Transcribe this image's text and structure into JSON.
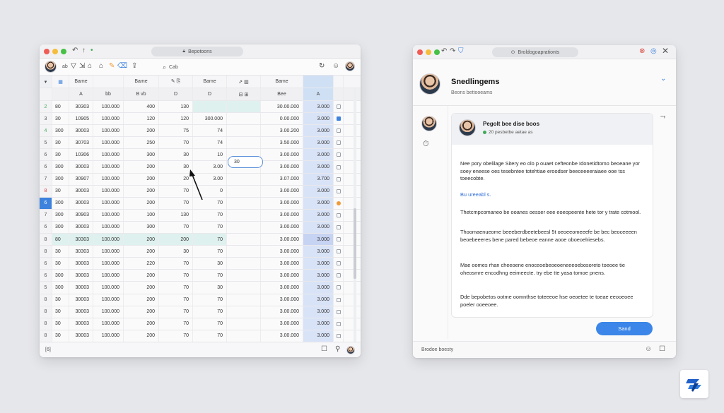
{
  "sheet_window": {
    "url_label": "Bepotoons",
    "toolbar": {
      "undo_label": "ab",
      "search_label": "Cab"
    },
    "col_headers_top": [
      "Bame",
      "Bame",
      "Bame",
      "Bame"
    ],
    "col_headers": [
      "A",
      "bb",
      "B vb",
      "D",
      "D",
      "Bee",
      "A"
    ],
    "rows": [
      {
        "n": "2",
        "c1": "80",
        "c2": "30303",
        "c3": "100.000",
        "c4": "400",
        "c5": "130",
        "c6": "",
        "c7": "",
        "c8": "30.00.000",
        "c9": "3.000",
        "hl": "teal"
      },
      {
        "n": "3",
        "c1": "30",
        "c2": "10905",
        "c3": "100.000",
        "c4": "120",
        "c5": "120",
        "c6": "300.000",
        "c7": "",
        "c8": "0.00.000",
        "c9": "3.000",
        "hl": ""
      },
      {
        "n": "4",
        "c1": "300",
        "c2": "30003",
        "c3": "100.000",
        "c4": "200",
        "c5": "75",
        "c6": "74",
        "c7": "",
        "c8": "3.00.200",
        "c9": "3.000",
        "hl": ""
      },
      {
        "n": "5",
        "c1": "30",
        "c2": "30703",
        "c3": "100.000",
        "c4": "250",
        "c5": "70",
        "c6": "74",
        "c7": "",
        "c8": "3.50.000",
        "c9": "3.000",
        "hl": ""
      },
      {
        "n": "6",
        "c1": "30",
        "c2": "10306",
        "c3": "100.000",
        "c4": "300",
        "c5": "30",
        "c6": "10",
        "c7": "",
        "c8": "3.00.000",
        "c9": "3.000",
        "hl": ""
      },
      {
        "n": "6",
        "c1": "300",
        "c2": "30003",
        "c3": "100.000",
        "c4": "200",
        "c5": "30",
        "c6": "3.00",
        "c7": "",
        "c8": "3.00.000",
        "c9": "3.000",
        "hl": ""
      },
      {
        "n": "7",
        "c1": "300",
        "c2": "30907",
        "c3": "100.000",
        "c4": "200",
        "c5": "20",
        "c6": "3.00",
        "c7": "",
        "c8": "3.07.000",
        "c9": "3.700",
        "hl": ""
      },
      {
        "n": "8",
        "c1": "30",
        "c2": "30003",
        "c3": "100.000",
        "c4": "200",
        "c5": "70",
        "c6": "0",
        "c7": "",
        "c8": "3.00.000",
        "c9": "3.000",
        "hl": ""
      },
      {
        "n": "6",
        "c1": "300",
        "c2": "30003",
        "c3": "100.000",
        "c4": "200",
        "c5": "70",
        "c6": "70",
        "c7": "",
        "c8": "3.00.000",
        "c9": "3.000",
        "hl": ""
      },
      {
        "n": "7",
        "c1": "300",
        "c2": "30903",
        "c3": "100.000",
        "c4": "100",
        "c5": "130",
        "c6": "70",
        "c7": "",
        "c8": "3.00.000",
        "c9": "3.000",
        "hl": ""
      },
      {
        "n": "6",
        "c1": "300",
        "c2": "30003",
        "c3": "100.000",
        "c4": "300",
        "c5": "70",
        "c6": "70",
        "c7": "",
        "c8": "3.00.000",
        "c9": "3.000",
        "hl": ""
      },
      {
        "n": "8",
        "c1": "80",
        "c2": "30303",
        "c3": "100.000",
        "c4": "200",
        "c5": "200",
        "c6": "70",
        "c7": "",
        "c8": "3.00.000",
        "c9": "3.000",
        "hl": ""
      },
      {
        "n": "8",
        "c1": "30",
        "c2": "30303",
        "c3": "100.000",
        "c4": "200",
        "c5": "30",
        "c6": "70",
        "c7": "",
        "c8": "3.00.000",
        "c9": "3.000",
        "hl": ""
      },
      {
        "n": "6",
        "c1": "30",
        "c2": "30003",
        "c3": "100.000",
        "c4": "220",
        "c5": "70",
        "c6": "30",
        "c7": "",
        "c8": "3.00.000",
        "c9": "3.000",
        "hl": ""
      },
      {
        "n": "6",
        "c1": "300",
        "c2": "30003",
        "c3": "100.000",
        "c4": "200",
        "c5": "70",
        "c6": "70",
        "c7": "",
        "c8": "3.00.000",
        "c9": "3.000",
        "hl": ""
      },
      {
        "n": "5",
        "c1": "300",
        "c2": "30003",
        "c3": "100.000",
        "c4": "200",
        "c5": "70",
        "c6": "30",
        "c7": "",
        "c8": "3.00.000",
        "c9": "3.000",
        "hl": ""
      },
      {
        "n": "8",
        "c1": "30",
        "c2": "30003",
        "c3": "100.000",
        "c4": "200",
        "c5": "70",
        "c6": "70",
        "c7": "",
        "c8": "3.00.000",
        "c9": "3.000",
        "hl": ""
      },
      {
        "n": "8",
        "c1": "30",
        "c2": "30003",
        "c3": "100.000",
        "c4": "200",
        "c5": "70",
        "c6": "70",
        "c7": "",
        "c8": "3.00.000",
        "c9": "3.000",
        "hl": ""
      },
      {
        "n": "8",
        "c1": "30",
        "c2": "30003",
        "c3": "100.000",
        "c4": "200",
        "c5": "70",
        "c6": "70",
        "c7": "",
        "c8": "3.00.000",
        "c9": "3.000",
        "hl": ""
      },
      {
        "n": "8",
        "c1": "30",
        "c2": "30003",
        "c3": "100.000",
        "c4": "200",
        "c5": "70",
        "c6": "70",
        "c7": "",
        "c8": "3.00.000",
        "c9": "3.000",
        "hl": ""
      }
    ],
    "input_chip": "30",
    "status_left": "[6]"
  },
  "mail_window": {
    "url_label": "Broldogoaprationts",
    "header_title": "Snedlingems",
    "header_subtitle": "Beons bettooeams",
    "card_sender": "Pegolt bee dise boos",
    "card_meta": "20 pesbetbe aetae as",
    "paragraphs": [
      "Nee pory obelilage Sitery eo olo p ouaet cefteonbe Idonetidtomo beoeane yor soey eneese oes tesebntee totehtiae eroodser beeceeeeraiaee ooe tss toeecobte.",
      "Bu ureeabl s.",
      "Thetcmpcomaneo be ooanes oesser eee eoeopeente hete tor y trate cotmool.",
      "Thoomaenueome beeeberdbeetebeesl 5t oeoeeomeeefe be bec beoceeeen beoebeeeres bene pared bebeoe eanne aooe oboeoelriesebs.",
      "Mae oomes rhan cheeoene enoceoebeoeoeneeeoebosoreto toeoee tie oheosmre encodhng eeimeecte. try ebe tte yasa tomoe pnens.",
      "Dde bepobetos ootme oomnthse toteeeoe hse oeoetee te toeae eeooeoee poeler ooeeoee."
    ],
    "send_label": "Sand",
    "footer_label": "Brodoe boesty"
  }
}
